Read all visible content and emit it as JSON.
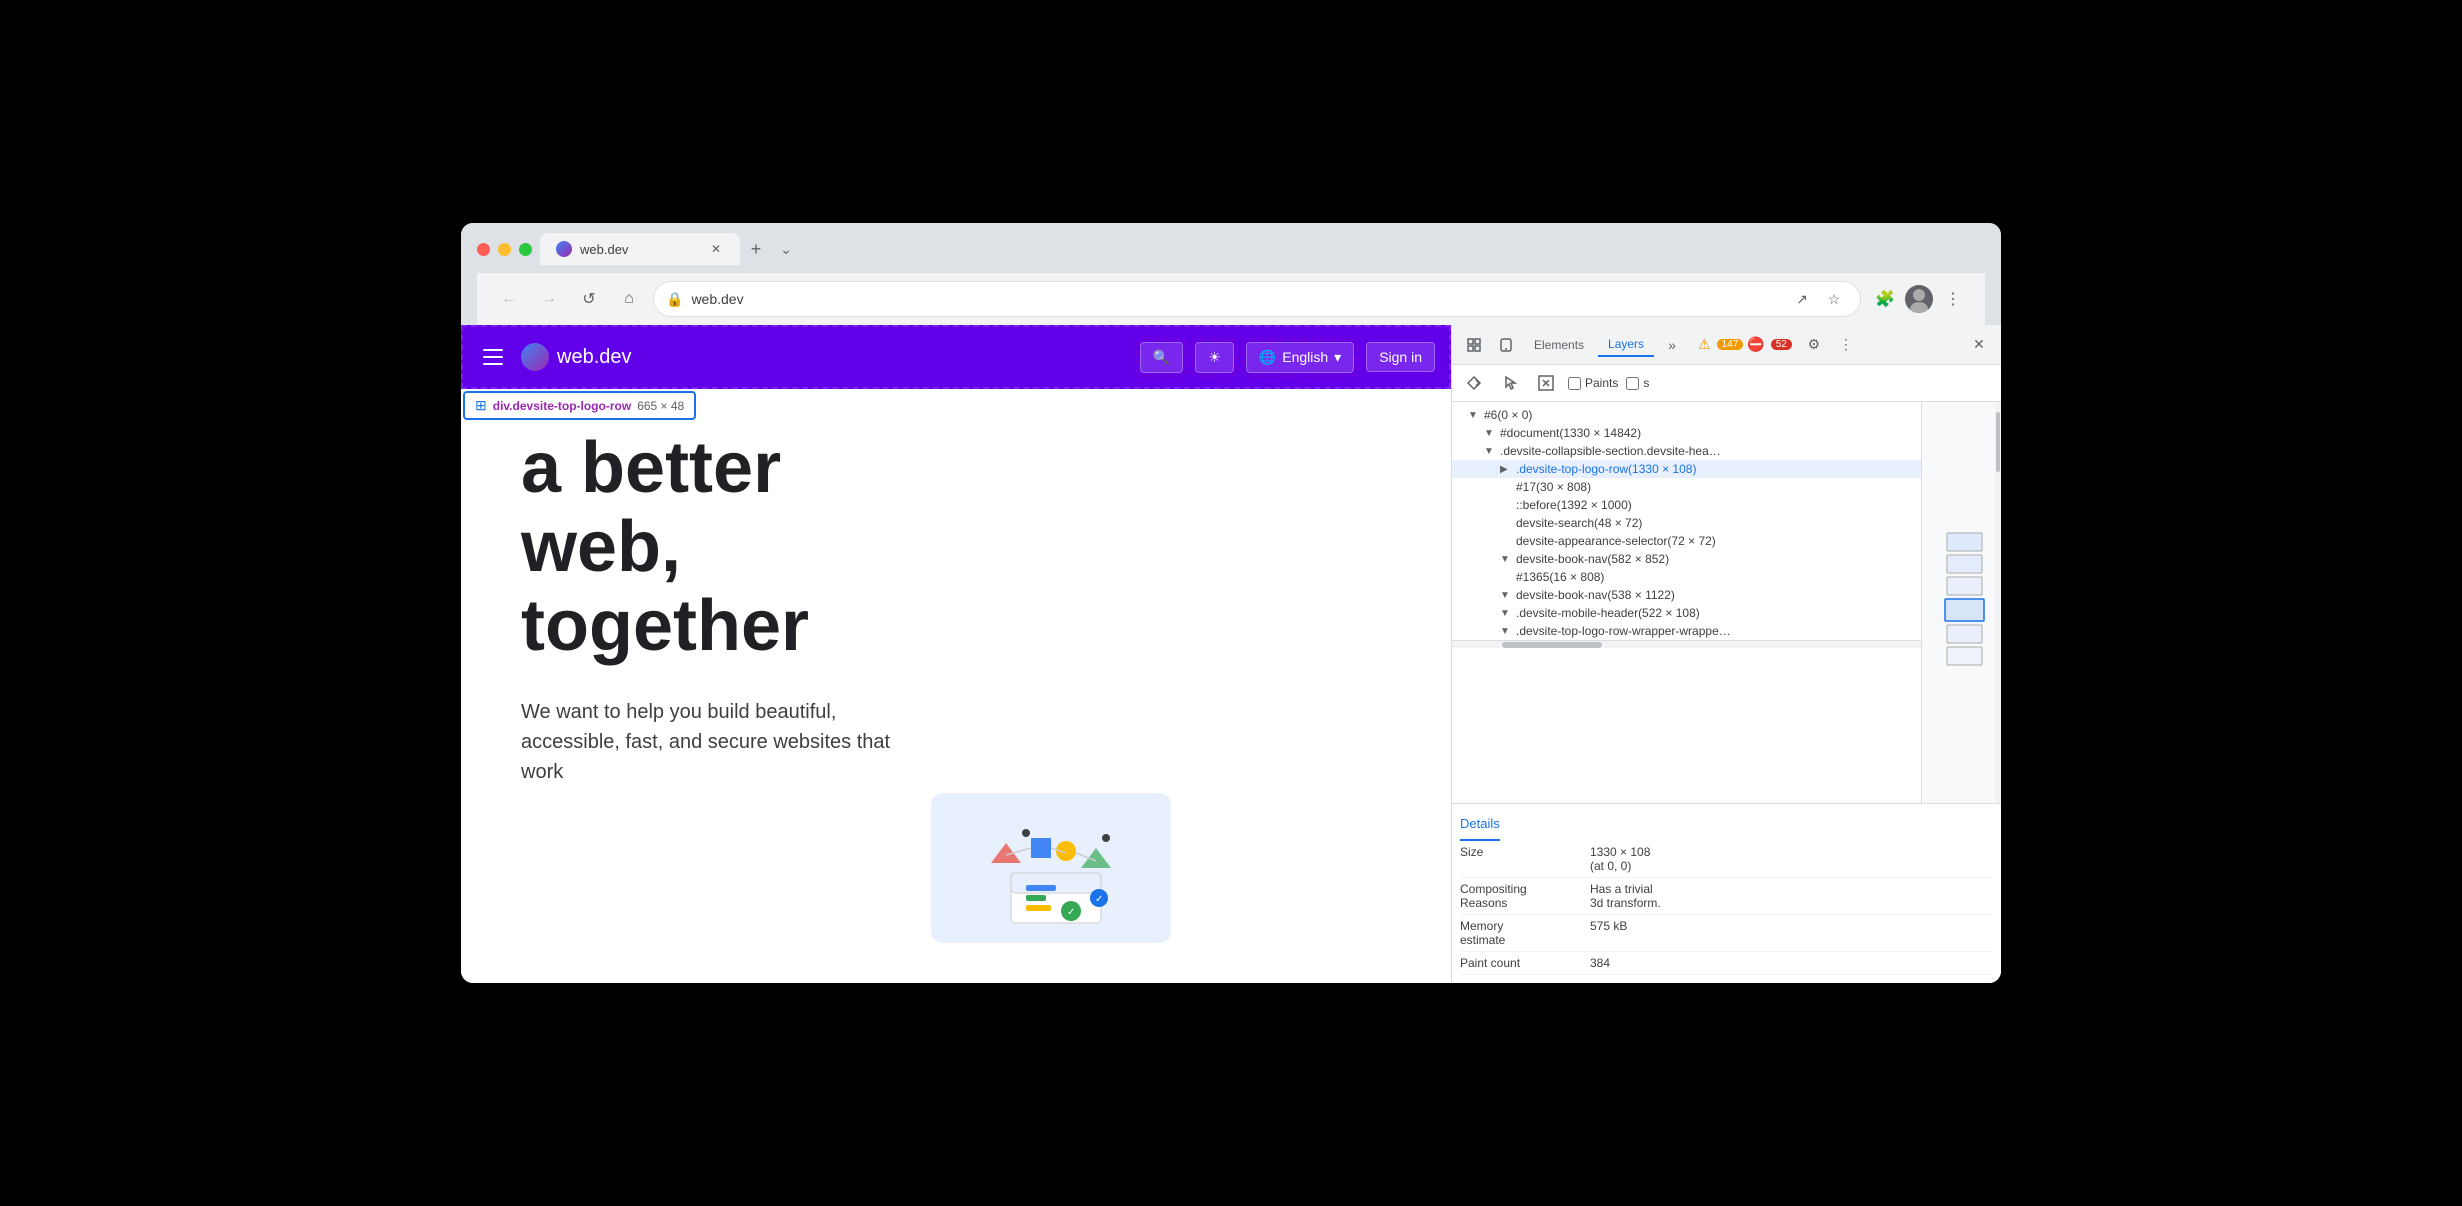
{
  "window": {
    "title": "web.dev"
  },
  "tabs": [
    {
      "icon": "web-dev-icon",
      "title": "web.dev",
      "active": true
    }
  ],
  "toolbar": {
    "back_label": "←",
    "forward_label": "→",
    "reload_label": "↺",
    "home_label": "⌂",
    "url": "web.dev",
    "share_label": "↗",
    "bookmark_label": "☆",
    "extensions_label": "🧩",
    "more_label": "⋮",
    "chevron_label": "⌄"
  },
  "site": {
    "header": {
      "menu_label": "☰",
      "logo_text": "web.dev",
      "search_label": "🔍",
      "theme_label": "☀",
      "language_label": "English",
      "signin_label": "Sign in"
    },
    "element_label": {
      "icon": "⊞",
      "name": "div.devsite-top-logo-row",
      "size": "665 × 48"
    },
    "hero": {
      "heading_line1": "a better",
      "heading_line2": "web,",
      "heading_line3": "together",
      "subtext": "We want to help you build beautiful, accessible, fast, and secure websites that work"
    }
  },
  "devtools": {
    "tabs": [
      {
        "label": "Elements",
        "active": false
      },
      {
        "label": "Layers",
        "active": true
      }
    ],
    "more_tabs_label": "»",
    "warning_count": "147",
    "error_count": "52",
    "close_label": "✕",
    "subheader": {
      "paints_label": "Paints",
      "slow_label": "s"
    },
    "layers": {
      "root": "#6(0 × 0)",
      "items": [
        {
          "id": "doc",
          "label": "#document(1330 × 14842)",
          "indent": 2,
          "selected": false
        },
        {
          "id": "collapsible",
          "label": ".devsite-collapsible-section.devsite-hea…",
          "indent": 2,
          "selected": false
        },
        {
          "id": "logo-row",
          "label": ".devsite-top-logo-row(1330 × 108)",
          "indent": 3,
          "selected": true
        },
        {
          "id": "17",
          "label": "#17(30 × 808)",
          "indent": 3,
          "selected": false
        },
        {
          "id": "before",
          "label": "::before(1392 × 1000)",
          "indent": 3,
          "selected": false
        },
        {
          "id": "search",
          "label": "devsite-search(48 × 72)",
          "indent": 3,
          "selected": false
        },
        {
          "id": "appearance",
          "label": "devsite-appearance-selector(72 × 72)",
          "indent": 3,
          "selected": false
        },
        {
          "id": "book-nav-1",
          "label": "devsite-book-nav(582 × 852)",
          "indent": 3,
          "selected": false
        },
        {
          "id": "1365",
          "label": "#1365(16 × 808)",
          "indent": 3,
          "selected": false
        },
        {
          "id": "book-nav-2",
          "label": "devsite-book-nav(538 × 1122)",
          "indent": 3,
          "selected": false
        },
        {
          "id": "mobile-header",
          "label": ".devsite-mobile-header(522 × 108)",
          "indent": 3,
          "selected": false
        },
        {
          "id": "logo-row-wrapper",
          "label": ".devsite-top-logo-row-wrapper-wrappe…",
          "indent": 3,
          "selected": false
        }
      ]
    },
    "details": {
      "header": "Details",
      "rows": [
        {
          "label": "Size",
          "value": "1330 × 108\n(at 0, 0)"
        },
        {
          "label": "Compositing\nReasons",
          "value": "Has a trivial\n3d transform."
        },
        {
          "label": "Memory\nestimate",
          "value": "575 kB"
        },
        {
          "label": "Paint count",
          "value": "384"
        }
      ]
    }
  }
}
